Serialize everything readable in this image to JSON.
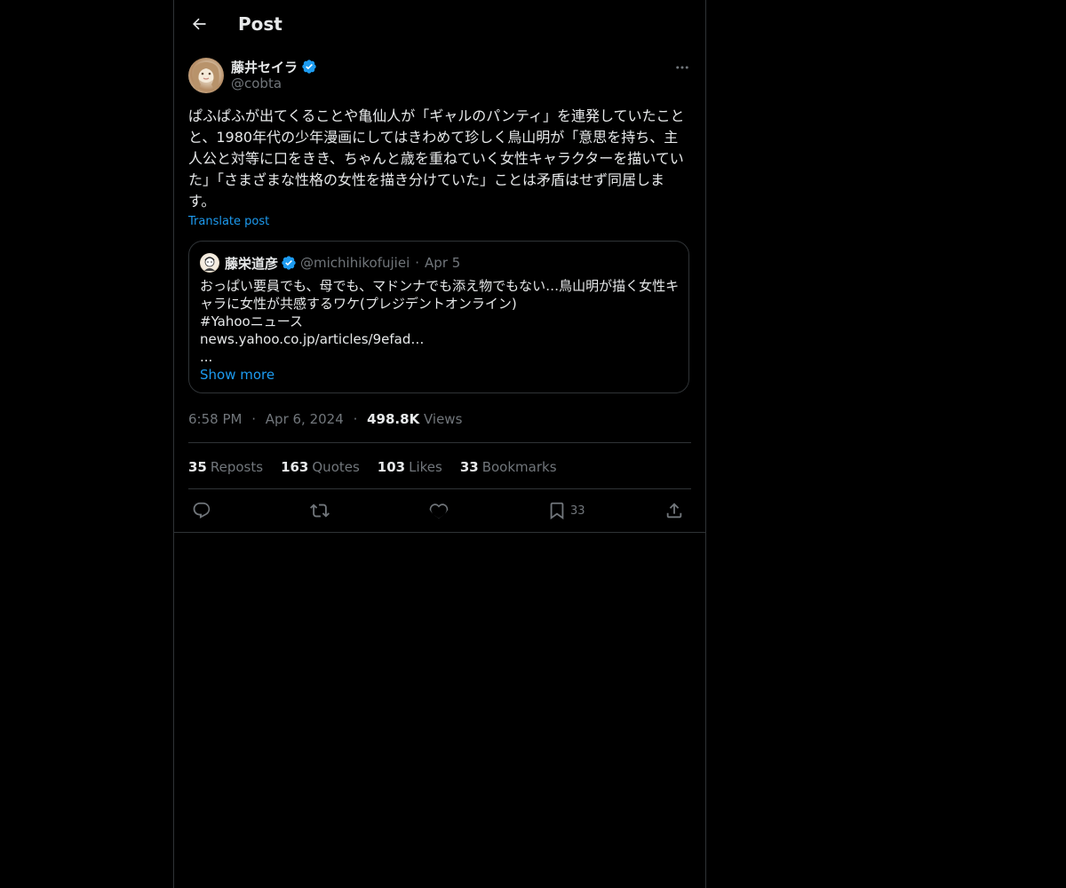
{
  "header": {
    "title": "Post"
  },
  "author": {
    "name": "藤井セイラ",
    "handle": "@cobta",
    "verified": true
  },
  "post": {
    "text": "ぱふぱふが出てくることや亀仙人が「ギャルのパンティ」を連発していたことと、1980年代の少年漫画にしてはきわめて珍しく鳥山明が「意思を持ち、主人公と対等に口をきき、ちゃんと歳を重ねていく女性キャラクターを描いていた」「さまざまな性格の女性を描き分けていた」ことは矛盾はせず同居します。",
    "translate_label": "Translate post"
  },
  "quote": {
    "name": "藤栄道彦",
    "handle": "@michihikofujiei",
    "separator": "·",
    "date": "Apr 5",
    "lines": [
      "おっぱい要員でも、母でも、マドンナでも添え物でもない…鳥山明が描く女性キ",
      "ャラに女性が共感するワケ(プレジデントオンライン)",
      "#Yahooニュース",
      "news.yahoo.co.jp/articles/9efad…",
      "..."
    ],
    "show_more": "Show more"
  },
  "meta": {
    "time": "6:58 PM",
    "sep": "·",
    "date": "Apr 6, 2024",
    "views_count": "498.8K",
    "views_label": "Views"
  },
  "stats": {
    "reposts_count": "35",
    "reposts_label": "Reposts",
    "quotes_count": "163",
    "quotes_label": "Quotes",
    "likes_count": "103",
    "likes_label": "Likes",
    "bookmarks_count": "33",
    "bookmarks_label": "Bookmarks"
  },
  "actions": {
    "bookmark_count": "33"
  },
  "colors": {
    "background": "#000000",
    "text": "#e7e9ea",
    "muted": "#71767b",
    "accent": "#1d9bf0",
    "border": "#2f3336"
  },
  "icons": {
    "back": "arrow-left-icon",
    "verified": "verified-badge-icon",
    "more": "more-horizontal-icon",
    "reply": "reply-icon",
    "repost": "repost-icon",
    "like": "heart-icon",
    "bookmark": "bookmark-icon",
    "share": "share-icon"
  }
}
